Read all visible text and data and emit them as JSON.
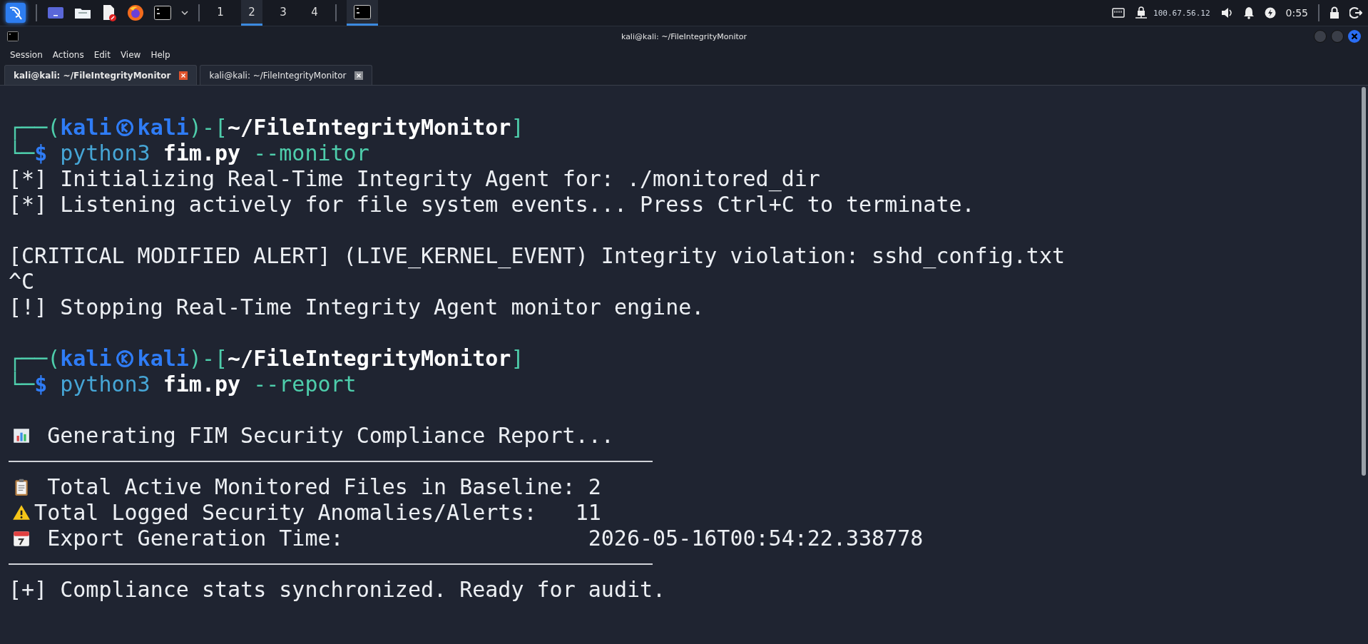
{
  "taskbar": {
    "workspaces": [
      {
        "label": "1",
        "selected": false
      },
      {
        "label": "2",
        "selected": true
      },
      {
        "label": "3",
        "selected": false
      },
      {
        "label": "4",
        "selected": false
      }
    ],
    "ip": "100.67.56.12",
    "clock": "0:55"
  },
  "window": {
    "title": "kali@kali: ~/FileIntegrityMonitor"
  },
  "menu": [
    "Session",
    "Actions",
    "Edit",
    "View",
    "Help"
  ],
  "tabs": [
    {
      "label": "kali@kali: ~/FileIntegrityMonitor",
      "selected": true
    },
    {
      "label": "kali@kali: ~/FileIntegrityMonitor",
      "selected": false
    }
  ],
  "terminal": {
    "lines": [
      {
        "kind": "blank"
      },
      {
        "kind": "prompt",
        "open": "┌──(",
        "user": "kali",
        "host": "kali",
        "mid": ")-[",
        "path": "~/FileIntegrityMonitor",
        "close": "]"
      },
      {
        "kind": "command",
        "corner": "└─",
        "sigil": "$",
        "program": "python3",
        "script": "fim.py",
        "args": "--monitor"
      },
      {
        "kind": "text",
        "text": "[*] Initializing Real-Time Integrity Agent for: ./monitored_dir"
      },
      {
        "kind": "text",
        "text": "[*] Listening actively for file system events... Press Ctrl+C to terminate."
      },
      {
        "kind": "blank"
      },
      {
        "kind": "text",
        "text": "[CRITICAL MODIFIED ALERT] (LIVE_KERNEL_EVENT) Integrity violation: sshd_config.txt"
      },
      {
        "kind": "text",
        "text": "^C"
      },
      {
        "kind": "text",
        "text": "[!] Stopping Real-Time Integrity Agent monitor engine."
      },
      {
        "kind": "blank"
      },
      {
        "kind": "prompt",
        "open": "┌──(",
        "user": "kali",
        "host": "kali",
        "mid": ")-[",
        "path": "~/FileIntegrityMonitor",
        "close": "]"
      },
      {
        "kind": "command",
        "corner": "└─",
        "sigil": "$",
        "program": "python3",
        "script": "fim.py",
        "args": "--report"
      },
      {
        "kind": "blank"
      },
      {
        "kind": "chart",
        "text": "Generating FIM Security Compliance Report..."
      },
      {
        "kind": "rule"
      },
      {
        "kind": "clipboard",
        "text": "Total Active Monitored Files in Baseline: 2"
      },
      {
        "kind": "warning",
        "text": "Total Logged Security Anomalies/Alerts:   11"
      },
      {
        "kind": "calendar",
        "text": "Export Generation Time:                   2026-05-16T00:54:22.338778"
      },
      {
        "kind": "rule"
      },
      {
        "kind": "text",
        "text": "[+] Compliance stats synchronized. Ready for audit."
      }
    ]
  }
}
